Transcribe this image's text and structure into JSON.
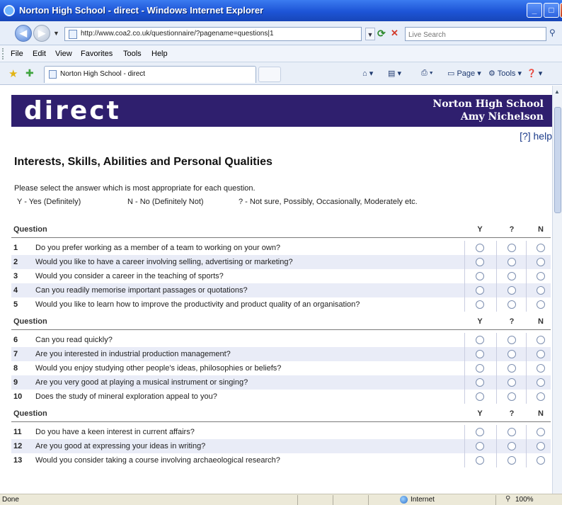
{
  "window": {
    "title": "Norton High School - direct - Windows Internet Explorer",
    "min_glyph": "_",
    "max_glyph": "□",
    "close_glyph": "X"
  },
  "address_bar": {
    "url": "http://www.coa2.co.uk/questionnaire/?pagename=questions|1",
    "search_placeholder": "Live Search"
  },
  "menu": [
    "File",
    "Edit",
    "View",
    "Favorites",
    "Tools",
    "Help"
  ],
  "tab": {
    "label": "Norton High School - direct"
  },
  "tools": {
    "page": "Page",
    "tools": "Tools"
  },
  "banner": {
    "logo": "direct",
    "school": "Norton High School",
    "user": "Amy Nichelson"
  },
  "help": {
    "label": "[?] help"
  },
  "page": {
    "heading": "Interests, Skills, Abilities and Personal Qualities",
    "instruction": "Please select the answer which is most appropriate for each question.",
    "legend": {
      "y": "Y - Yes (Definitely)",
      "n": "N - No (Definitely Not)",
      "q": "? - Not sure, Possibly, Occasionally, Moderately etc."
    }
  },
  "columns": {
    "question": "Question",
    "y": "Y",
    "q": "?",
    "n": "N"
  },
  "sections": [
    {
      "questions": [
        {
          "num": "1",
          "text": "Do you prefer working as a member of a team to working on your own?"
        },
        {
          "num": "2",
          "text": "Would you like to have a career involving selling, advertising or marketing?"
        },
        {
          "num": "3",
          "text": "Would you consider a career in the teaching of sports?"
        },
        {
          "num": "4",
          "text": "Can you readily memorise important passages or quotations?"
        },
        {
          "num": "5",
          "text": "Would you like to learn how to improve the productivity and product quality of an organisation?"
        }
      ]
    },
    {
      "questions": [
        {
          "num": "6",
          "text": "Can you read quickly?"
        },
        {
          "num": "7",
          "text": "Are you interested in industrial production management?"
        },
        {
          "num": "8",
          "text": "Would you enjoy studying other people's ideas, philosophies or beliefs?"
        },
        {
          "num": "9",
          "text": "Are you very good at playing a musical instrument or singing?"
        },
        {
          "num": "10",
          "text": "Does the study of mineral exploration appeal to you?"
        }
      ]
    },
    {
      "questions": [
        {
          "num": "11",
          "text": "Do you have a keen interest in current affairs?"
        },
        {
          "num": "12",
          "text": "Are you good at expressing your ideas in writing?"
        },
        {
          "num": "13",
          "text": "Would you consider taking a course involving archaeological research?"
        }
      ]
    }
  ],
  "status": {
    "left": "Done",
    "zone": "Internet",
    "zoom": "100%"
  },
  "colors": {
    "banner": "#2f1f6e",
    "row_shade": "#e9ecf7",
    "help_link": "#1a3a8a"
  }
}
